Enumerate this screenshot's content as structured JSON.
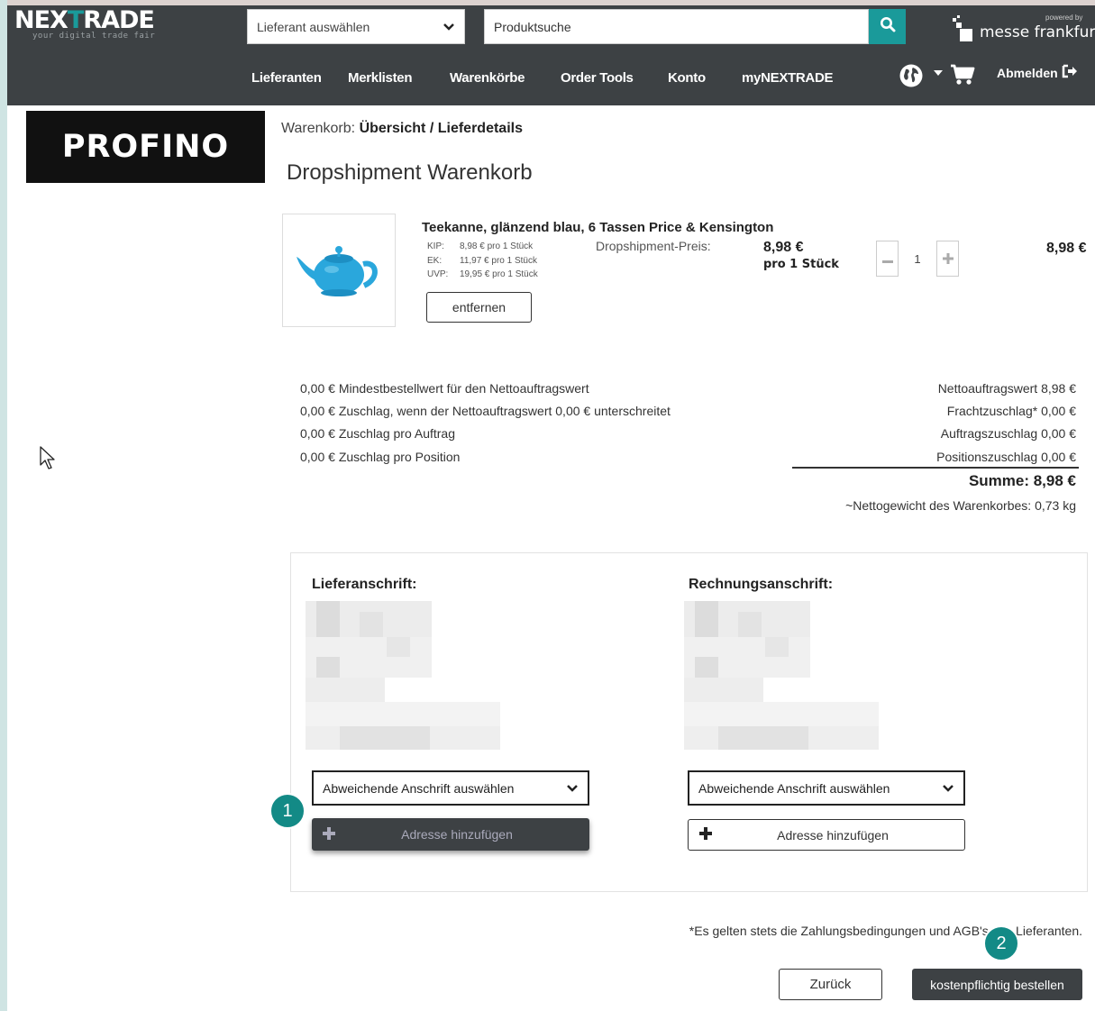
{
  "header": {
    "logo_text_pre": "NEX",
    "logo_text_t": "T",
    "logo_text_post": "RADE",
    "logo_tagline": "your digital trade fair",
    "supplier_select": "Lieferant auswählen",
    "search_placeholder": "Produktsuche",
    "powered_by": "powered by",
    "partner": "messe frankfurt",
    "nav": [
      "Lieferanten",
      "Merklisten",
      "Warenkörbe",
      "Order Tools",
      "Konto",
      "myNEXTRADE"
    ],
    "logout": "Abmelden"
  },
  "brand": "PROFINO",
  "breadcrumb": {
    "prefix": "Warenkorb:",
    "step1": "Übersicht",
    "sep": "/",
    "step2": "Lieferdetails"
  },
  "page_title": "Dropshipment Warenkorb",
  "product": {
    "title": "Teekanne, glänzend blau, 6 Tassen",
    "brand": "Price & Kensington",
    "price_rows": [
      {
        "k": "KIP:",
        "v": "8,98 € pro 1 Stück"
      },
      {
        "k": "EK:",
        "v": "11,97 € pro 1 Stück"
      },
      {
        "k": "UVP:",
        "v": "19,95 € pro 1 Stück"
      }
    ],
    "remove_label": "entfernen",
    "dropship_label": "Dropshipment-Preis:",
    "dropship_price": "8,98 €",
    "dropship_unit": "pro 1 Stück",
    "quantity": "1",
    "line_total": "8,98 €"
  },
  "conditions": [
    "0,00 € Mindestbestellwert für den Nettoauftragswert",
    "0,00 € Zuschlag, wenn der Nettoauftragswert 0,00 € unterschreitet",
    "0,00 € Zuschlag pro Auftrag",
    "0,00 € Zuschlag pro Position"
  ],
  "totals": [
    "Nettoauftragswert 8,98 €",
    "Frachtzuschlag* 0,00 €",
    "Auftragszuschlag 0,00 €",
    "Positionszuschlag 0,00 €"
  ],
  "sum": "Summe: 8,98 €",
  "weight": "~Nettogewicht des Warenkorbes: 0,73 kg",
  "shipping": {
    "heading": "Lieferanschrift:",
    "select": "Abweichende Anschrift auswählen",
    "add": "Adresse hinzufügen"
  },
  "billing": {
    "heading": "Rechnungsanschrift:",
    "select": "Abweichende Anschrift auswählen",
    "add": "Adresse hinzufügen"
  },
  "badges": [
    "1",
    "2"
  ],
  "agb_note": "*Es gelten stets die Zahlungsbedingungen und AGB's des Lieferanten.",
  "back_label": "Zurück",
  "order_label": "kostenpflichtig bestellen",
  "colors": {
    "accent": "#1a9a9a",
    "header": "#3d4144",
    "badge": "#138a86"
  }
}
